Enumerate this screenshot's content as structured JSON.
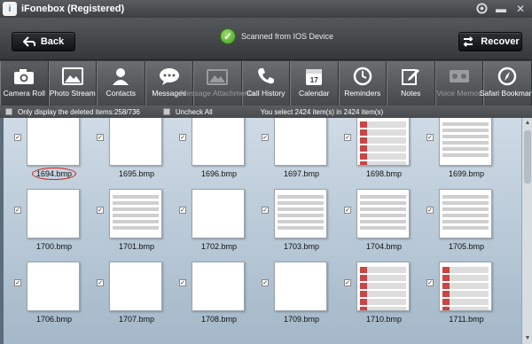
{
  "window": {
    "title": "iFonebox (Registered)",
    "logo_letter": "i"
  },
  "actions": {
    "back_label": "Back",
    "recover_label": "Recover",
    "status_text": "Scanned from IOS Device"
  },
  "categories": [
    {
      "label": "Camera Roll",
      "icon": "camera-icon",
      "disabled": false
    },
    {
      "label": "Photo Stream",
      "icon": "photo-icon",
      "disabled": false
    },
    {
      "label": "Contacts",
      "icon": "person-icon",
      "disabled": false
    },
    {
      "label": "Messages",
      "icon": "chat-bubble-icon",
      "disabled": false
    },
    {
      "label": "Message Attachments",
      "icon": "attachment-icon",
      "disabled": true
    },
    {
      "label": "Call History",
      "icon": "phone-icon",
      "disabled": false
    },
    {
      "label": "Calendar",
      "icon": "calendar-icon",
      "disabled": false,
      "day": "17"
    },
    {
      "label": "Reminders",
      "icon": "clock-icon",
      "disabled": false
    },
    {
      "label": "Notes",
      "icon": "notepad-icon",
      "disabled": false
    },
    {
      "label": "Voice Memos",
      "icon": "voice-memo-icon",
      "disabled": true
    },
    {
      "label": "Safari Bookmark",
      "icon": "compass-icon",
      "disabled": false
    }
  ],
  "filter": {
    "only_deleted_label": "Only display the deleted items:258/736",
    "uncheck_all_label": "Uncheck All",
    "selection_text": "You select 2424 item(s) in 2424 item(s)"
  },
  "files": [
    {
      "name": "1694.bmp",
      "style": "t-photo-red",
      "checked": true,
      "highlighted": true
    },
    {
      "name": "1695.bmp",
      "style": "t-photo-dark",
      "checked": true
    },
    {
      "name": "1696.bmp",
      "style": "t-photo-dark",
      "checked": true
    },
    {
      "name": "1697.bmp",
      "style": "t-keyboard",
      "checked": true
    },
    {
      "name": "1698.bmp",
      "style": "t-apps",
      "checked": true
    },
    {
      "name": "1699.bmp",
      "style": "t-list",
      "checked": true
    },
    {
      "name": "1700.bmp",
      "style": "t-keyboard",
      "checked": true
    },
    {
      "name": "1701.bmp",
      "style": "t-list",
      "checked": true
    },
    {
      "name": "1702.bmp",
      "style": "t-art",
      "checked": true
    },
    {
      "name": "1703.bmp",
      "style": "t-list",
      "checked": true
    },
    {
      "name": "1704.bmp",
      "style": "t-list",
      "checked": true
    },
    {
      "name": "1705.bmp",
      "style": "t-list",
      "checked": true
    },
    {
      "name": "1706.bmp",
      "style": "t-art",
      "checked": true
    },
    {
      "name": "1707.bmp",
      "style": "t-woman",
      "checked": true
    },
    {
      "name": "1708.bmp",
      "style": "t-tattoo",
      "checked": true
    },
    {
      "name": "1709.bmp",
      "style": "t-tattoo",
      "checked": true
    },
    {
      "name": "1710.bmp",
      "style": "t-apps",
      "checked": true
    },
    {
      "name": "1711.bmp",
      "style": "t-apps",
      "checked": true
    }
  ]
}
